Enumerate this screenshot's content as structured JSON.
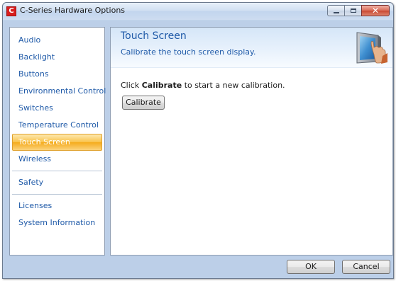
{
  "window": {
    "title": "C-Series Hardware Options",
    "app_icon_letter": "C",
    "caption_buttons": {
      "close_glyph": "✕"
    }
  },
  "sidebar": {
    "groups": [
      [
        "Audio",
        "Backlight",
        "Buttons",
        "Environmental Control",
        "Switches",
        "Temperature Control",
        "Touch Screen",
        "Wireless"
      ],
      [
        "Safety"
      ],
      [
        "Licenses",
        "System Information"
      ]
    ],
    "selected": "Touch Screen"
  },
  "content": {
    "title": "Touch Screen",
    "subtitle": "Calibrate the touch screen display.",
    "header_icon": "touch-monitor-icon",
    "instruction": {
      "before": "Click ",
      "bold": "Calibrate",
      "after": " to start a new calibration."
    },
    "calibrate_button": "Calibrate"
  },
  "footer": {
    "ok_label": "OK",
    "cancel_label": "Cancel"
  },
  "colors": {
    "link_blue": "#1f5aa8",
    "selection_orange": "#f5ab1c",
    "close_red": "#c84631"
  }
}
